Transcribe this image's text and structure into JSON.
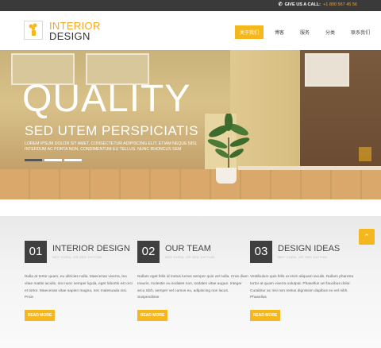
{
  "topbar": {
    "call_label": "GIVE US A CALL:",
    "phone": "+1 800 567 45 56"
  },
  "logo": {
    "line1": "INTERIOR",
    "line2": "DESIGN"
  },
  "nav": {
    "items": [
      "关于我们",
      "博客",
      "服务",
      "分类",
      "联系我们"
    ],
    "active_index": 0
  },
  "hero": {
    "title": "QUALITY",
    "subtitle": "SED UTEM PERSPICIATIS",
    "description": "LOREM IPSUM DOLOR SIT AMET, CONSECTETUR ADIPISCING ELIT. ETIAM NEQUE NISI, INTERDUM AC PORTA NON, CONDIMENTUM EU TELLUS. NUNC RHONCUS SEM",
    "slide_count": 3,
    "active_slide": 0
  },
  "features": [
    {
      "number": "01",
      "title": "INTERIOR DESIGN",
      "subtitle": "NEC CURA, OR SED DICTUM",
      "text": "Nulla at tortor quam, eu ultricies nulla. Maecenas viverra, leo vitae mattis iaculis, nisi nunc semper ligula, eget lobortis est orci et tortor. Maecenas vitae sapien magna, nec malesuada nisi. Proin",
      "button": "READ MORE"
    },
    {
      "number": "02",
      "title": "OUR TEAM",
      "subtitle": "NEC CURA, OR SED DICTUM",
      "text": "Nullam eget felis id metus luctus semper quis vel nulla. Cras diam mauris, molestie eu sodales non, sodales vitae augue. Integer arcu nibh, semper vel cursus eu, adipiscing non lacus. Suspendisse",
      "button": "READ MORE"
    },
    {
      "number": "03",
      "title": "DESIGN IDEAS",
      "subtitle": "NEC CURA, OR SED DICTUM",
      "text": "Vestibulum quis felis ut enim aliquam iaculis. Nullam pharetra tortor at quam viverra volutpat. Phasellus vel faucibus dolor. Curabitur ac nisi non metus dignissim dapibus eu vel nibh. Phasellus",
      "button": "READ MORE"
    }
  ],
  "colors": {
    "accent": "#f5b71e",
    "dark": "#3f3f3f",
    "topbar": "#3a3a3a"
  },
  "icons": {
    "phone": "phone-icon",
    "scroll_top": "chevron-up-icon",
    "slider_next": "chevron-right-icon"
  }
}
